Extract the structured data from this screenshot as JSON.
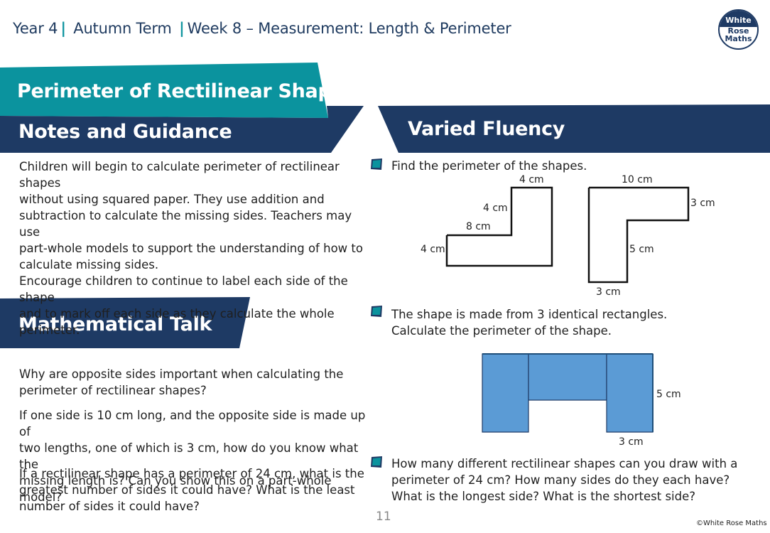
{
  "header": {
    "year": "Year 4",
    "term": "Autumn Term",
    "week": "Week 8 – Measurement: Length & Perimeter",
    "separator": "|"
  },
  "logo": {
    "line1": "White",
    "line2": "Rose",
    "line3": "Maths"
  },
  "colors": {
    "teal": "#0b939e",
    "navy": "#1e3a64",
    "shape_blue": "#5b9bd5",
    "text": "#1f1f1f"
  },
  "lesson_title": "Perimeter of Rectilinear Shapes",
  "notes": {
    "heading": "Notes and Guidance",
    "lines": [
      "Children will begin to calculate perimeter of rectilinear shapes",
      "without using squared paper. They use addition and",
      "subtraction to calculate the missing sides. Teachers may use",
      "part-whole models to support the understanding of how to",
      "calculate missing sides.",
      "Encourage children to continue to label each side of the shape",
      "and to mark off each side as they calculate the whole",
      "perimeter."
    ]
  },
  "talk": {
    "heading": "Mathematical Talk",
    "questions": [
      [
        "Why are opposite sides important when calculating the",
        "perimeter of rectilinear shapes?"
      ],
      [
        "If one side is 10 cm long, and the opposite side is made up of",
        "two lengths, one of which is 3 cm, how do you know what the",
        "missing length is? Can you show this on a part-whole model?"
      ],
      [
        "If a rectilinear shape has a perimeter of 24 cm, what is the",
        "greatest number of sides it could have? What is the least",
        "number of sides it could have?"
      ]
    ]
  },
  "fluency": {
    "heading": "Varied Fluency",
    "q1": {
      "text": "Find the perimeter of the shapes.",
      "shape_a_labels": {
        "top": "4 cm",
        "inner_vertical": "4 cm",
        "inner_horizontal": "8 cm",
        "left": "4 cm"
      },
      "shape_b_labels": {
        "top": "10 cm",
        "right": "3 cm",
        "inner_vertical": "5 cm",
        "bottom": "3 cm"
      }
    },
    "q2": {
      "lines": [
        "The shape is made from 3 identical rectangles.",
        "Calculate the perimeter of the shape."
      ],
      "labels": {
        "height": "5 cm",
        "width": "3 cm"
      }
    },
    "q3": {
      "lines": [
        "How many different rectilinear shapes can you draw with a",
        "perimeter of 24 cm? How many sides do they each have?",
        "What is the longest side? What is the shortest side?"
      ]
    }
  },
  "footer": {
    "page_number": "11",
    "copyright": "©White Rose Maths"
  }
}
